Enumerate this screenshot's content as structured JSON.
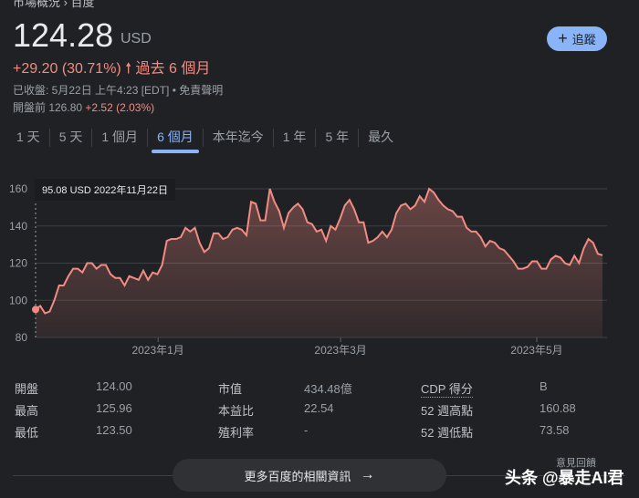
{
  "breadcrumb": "市場概況 › 百度",
  "price": "124.28",
  "currency": "USD",
  "change": "+29.20 (30.71%)",
  "change_period": "過去 6 個月",
  "closed_info": "已收盤: 5月22日 上午4:23 [EDT] • 免責聲明",
  "premarket": {
    "label": "開盤前 126.80",
    "change": "+2.52 (2.03%)"
  },
  "follow_label": "追蹤",
  "tabs": [
    "1 天",
    "5 天",
    "1 個月",
    "6 個月",
    "本年迄今",
    "1 年",
    "5 年",
    "最久"
  ],
  "active_tab": "6 個月",
  "tooltip": "95.08 USD  2022年11月22日",
  "stats": [
    [
      {
        "label": "開盤",
        "value": "124.00"
      },
      {
        "label": "市值",
        "value": "434.48億"
      },
      {
        "label": "CDP 得分",
        "value": "B"
      }
    ],
    [
      {
        "label": "最高",
        "value": "125.96"
      },
      {
        "label": "本益比",
        "value": "22.54"
      },
      {
        "label": "52 週高點",
        "value": "160.88"
      }
    ],
    [
      {
        "label": "最低",
        "value": "123.50"
      },
      {
        "label": "殖利率",
        "value": "-"
      },
      {
        "label": "52 週低點",
        "value": "73.58"
      }
    ]
  ],
  "more_button": "更多百度的相關資訊",
  "feedback": "意見回饋",
  "watermark": "头条 @暴走AI君",
  "colors": {
    "line": "#f28b82",
    "accent": "#8ab4f8"
  },
  "chart_data": {
    "type": "area",
    "title": "",
    "xlabel": "",
    "ylabel": "",
    "ylim": [
      80,
      160
    ],
    "yticks": [
      "80",
      "100",
      "120",
      "140",
      "160"
    ],
    "xticks": [
      {
        "label": "2023年1月",
        "pos": 0.216
      },
      {
        "label": "2023年3月",
        "pos": 0.538
      },
      {
        "label": "2023年5月",
        "pos": 0.884
      }
    ],
    "start": "2022年11月22日",
    "start_value": 95.08,
    "values": [
      95,
      97,
      93,
      94,
      100,
      108,
      108,
      113,
      117,
      117,
      115,
      120,
      120,
      117,
      119,
      119,
      114,
      112,
      112,
      108,
      113,
      112,
      111,
      116,
      111,
      115,
      114,
      119,
      132,
      133,
      133,
      134,
      139,
      137,
      139,
      131,
      126,
      128,
      136,
      136,
      133,
      134,
      138,
      139,
      138,
      135,
      153,
      152,
      143,
      143,
      160,
      153,
      148,
      139,
      147,
      150,
      152,
      149,
      142,
      141,
      137,
      138,
      132,
      140,
      138,
      144,
      151,
      154,
      149,
      142,
      142,
      131,
      132,
      134,
      137,
      134,
      138,
      147,
      151,
      152,
      149,
      151,
      156,
      153,
      160,
      158,
      154,
      151,
      149,
      148,
      145,
      145,
      139,
      137,
      137,
      134,
      129,
      132,
      131,
      128,
      127,
      124,
      121,
      117,
      117,
      118,
      121,
      121,
      117,
      117,
      122,
      124,
      123,
      120,
      119,
      124,
      120,
      128,
      133,
      131,
      125,
      124.28
    ]
  }
}
